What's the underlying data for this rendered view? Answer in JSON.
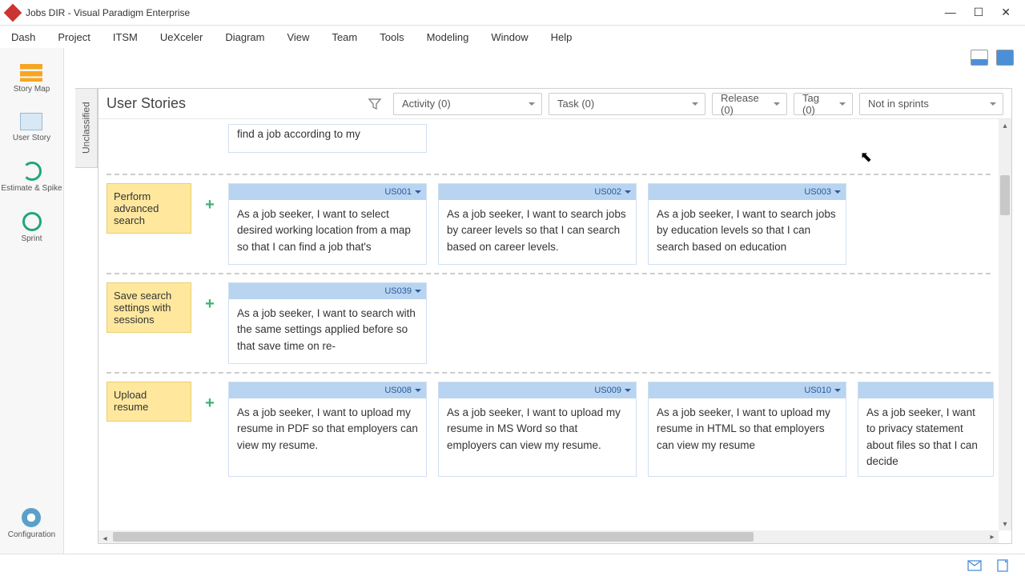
{
  "window": {
    "title": "Jobs DIR - Visual Paradigm Enterprise"
  },
  "menu": [
    "Dash",
    "Project",
    "ITSM",
    "UeXceler",
    "Diagram",
    "View",
    "Team",
    "Tools",
    "Modeling",
    "Window",
    "Help"
  ],
  "rail": {
    "storymap": "Story Map",
    "userstory": "User Story",
    "estimate": "Estimate & Spike",
    "sprint": "Sprint",
    "config": "Configuration"
  },
  "vtab": "Unclassified",
  "filter": {
    "heading": "User Stories",
    "activity": "Activity (0)",
    "task": "Task (0)",
    "release": "Release (0)",
    "tag": "Tag (0)",
    "sprints": "Not in sprints"
  },
  "rows": [
    {
      "fragment": true,
      "epic": "",
      "cards": [
        {
          "id": "",
          "text": "find a job according to my"
        }
      ]
    },
    {
      "epic": "Perform advanced search",
      "cards": [
        {
          "id": "US001",
          "text": "As a job seeker, I want to select desired working location from a map so that I can find a job that's"
        },
        {
          "id": "US002",
          "text": "As a job seeker, I want to search jobs by career levels so that I can search based on career levels."
        },
        {
          "id": "US003",
          "text": "As a job seeker, I want to search jobs by education levels so that I can search based on education"
        }
      ]
    },
    {
      "epic": "Save search settings with sessions",
      "cards": [
        {
          "id": "US039",
          "text": "As a job seeker, I want to search with the same settings applied before so that save time on re-"
        }
      ]
    },
    {
      "epic": "Upload resume",
      "cards": [
        {
          "id": "US008",
          "text": "As a job seeker, I want to upload my resume in PDF so that employers can view my resume."
        },
        {
          "id": "US009",
          "text": "As a job seeker, I want to upload my resume in MS Word so that employers can view my resume."
        },
        {
          "id": "US010",
          "text": "As a job seeker, I want to upload my resume in HTML so that employers can view my resume"
        },
        {
          "id": "",
          "text": "As a job seeker, I want to privacy statement about files so that I can decide"
        }
      ]
    }
  ]
}
